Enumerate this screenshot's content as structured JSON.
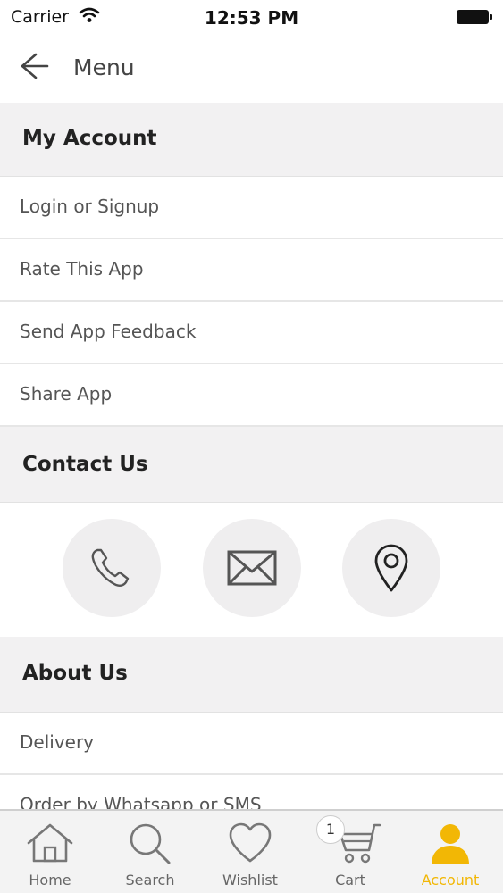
{
  "status": {
    "carrier": "Carrier",
    "time": "12:53 PM"
  },
  "nav": {
    "title": "Menu"
  },
  "sections": {
    "account": {
      "title": "My Account",
      "items": [
        "Login or Signup",
        "Rate This App",
        "Send App Feedback",
        "Share App"
      ]
    },
    "contact": {
      "title": "Contact Us",
      "icons": [
        "phone-icon",
        "mail-icon",
        "location-pin-icon"
      ]
    },
    "about": {
      "title": "About Us",
      "items": [
        "Delivery",
        "Order by Whatsapp or SMS"
      ]
    }
  },
  "tabbar": {
    "tabs": [
      {
        "label": "Home",
        "icon": "home-icon"
      },
      {
        "label": "Search",
        "icon": "search-icon"
      },
      {
        "label": "Wishlist",
        "icon": "heart-icon"
      },
      {
        "label": "Cart",
        "icon": "cart-icon",
        "badge": "1"
      },
      {
        "label": "Account",
        "icon": "person-icon",
        "active": true
      }
    ]
  },
  "colors": {
    "accent": "#f2b705",
    "section_bg": "#f2f1f2",
    "circle_bg": "#efeeef"
  }
}
